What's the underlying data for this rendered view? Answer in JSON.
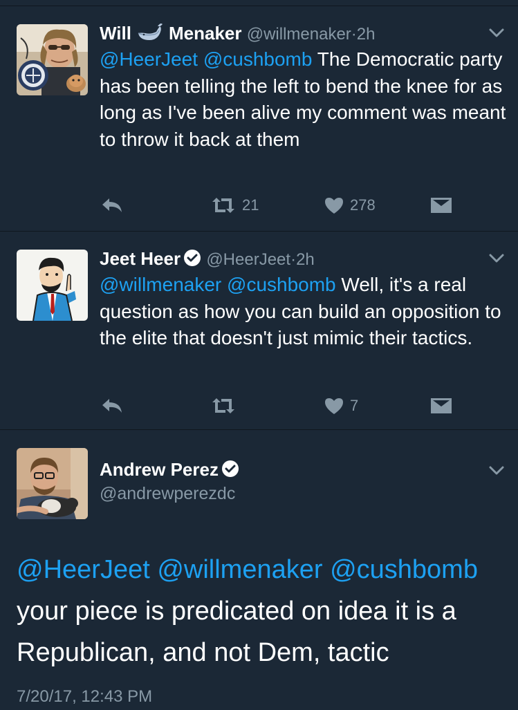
{
  "tweets": [
    {
      "name_part1": "Will",
      "name_part2": "Menaker",
      "handle": "@willmenaker",
      "separator": "·",
      "time": "2h",
      "body_mentions": "@HeerJeet @cushbomb",
      "body_text": " The Democratic party has been telling the left to bend the knee for as long as I've been alive my comment was meant to throw it back at them",
      "retweet_count": "21",
      "like_count": "278"
    },
    {
      "name": "Jeet Heer",
      "handle": "@HeerJeet",
      "separator": "·",
      "time": "2h",
      "body_mentions": "@willmenaker @cushbomb",
      "body_text": " Well, it's a real question as how you can build an opposition to the elite that doesn't just mimic their tactics.",
      "like_count": "7"
    },
    {
      "name": "Andrew Perez",
      "handle": "@andrewperezdc",
      "body_mentions": "@HeerJeet @willmenaker @cushbomb",
      "body_text": "your piece is predicated on idea it is a Republican, and not Dem, tactic",
      "timestamp": "7/20/17, 12:43 PM"
    }
  ],
  "colors": {
    "background": "#1b2836",
    "mention": "#1da1f2",
    "muted": "#8899a6",
    "divider": "#10171e"
  }
}
